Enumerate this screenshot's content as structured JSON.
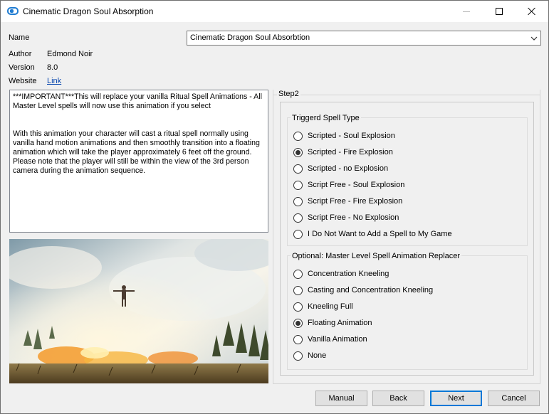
{
  "window": {
    "title": "Cinematic Dragon Soul Absorption"
  },
  "info": {
    "name_label": "Name",
    "author_label": "Author",
    "author_value": "Edmond Noir",
    "version_label": "Version",
    "version_value": "8.0",
    "website_label": "Website",
    "website_link": "Link"
  },
  "name_select": {
    "selected": "Cinematic Dragon Soul Absorbtion"
  },
  "description": "***IMPORTANT***This will replace your vanilla Ritual Spell Animations - All Master Level spells will now use this animation if you select\n\n\nWith this animation your character will cast a ritual spell normally using vanilla hand motion animations and then smoothly transition into a floating animation which will take the player approximately 6 feet off the ground. Please note that the player will still be within the view of the 3rd person camera during the animation sequence.",
  "step": {
    "label": "Step2",
    "groups": [
      {
        "legend": "Triggerd Spell Type",
        "options": [
          {
            "label": "Scripted - Soul Explosion",
            "checked": false
          },
          {
            "label": "Scripted - Fire Explosion",
            "checked": true
          },
          {
            "label": "Scripted - no Explosion",
            "checked": false
          },
          {
            "label": "Script Free - Soul Explosion",
            "checked": false
          },
          {
            "label": "Script Free - Fire Explosion",
            "checked": false
          },
          {
            "label": "Script Free - No Explosion",
            "checked": false
          },
          {
            "label": "I Do Not Want to Add a Spell to My Game",
            "checked": false
          }
        ]
      },
      {
        "legend": "Optional: Master Level Spell Animation Replacer",
        "options": [
          {
            "label": "Concentration Kneeling",
            "checked": false
          },
          {
            "label": "Casting and Concentration Kneeling",
            "checked": false
          },
          {
            "label": "Kneeling Full",
            "checked": false
          },
          {
            "label": "Floating Animation",
            "checked": true
          },
          {
            "label": "Vanilla Animation",
            "checked": false
          },
          {
            "label": "None",
            "checked": false
          }
        ]
      }
    ]
  },
  "buttons": {
    "manual": "Manual",
    "back": "Back",
    "next": "Next",
    "cancel": "Cancel"
  },
  "colors": {
    "accent": "#0078d7",
    "link": "#0645ad"
  }
}
